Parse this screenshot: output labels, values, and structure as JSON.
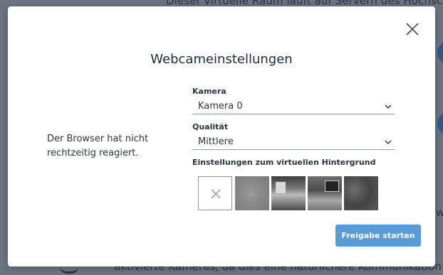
{
  "background": {
    "top_text": "Dieser virtuelle Raum läuft auf Servern des Hochsch",
    "bottom_text": "aktivierte Kameras, da dies eine natürlichere Kommunikation",
    "right_text": "w"
  },
  "modal": {
    "title": "Webcameinstellungen",
    "error_message": "Der Browser hat nicht rechtzeitig reagiert.",
    "camera": {
      "label": "Kamera",
      "value": "Kamera 0"
    },
    "quality": {
      "label": "Qualität",
      "value": "Mittlere"
    },
    "virtual_background": {
      "label": "Einstellungen zum virtuellen Hintergrund",
      "options": [
        "none",
        "blur",
        "image-1",
        "image-2",
        "image-3"
      ]
    },
    "start_button": "Freigabe starten",
    "close_icon": "close-icon"
  },
  "colors": {
    "primary_button": "#5b9bd5",
    "text": "#2b3542"
  }
}
